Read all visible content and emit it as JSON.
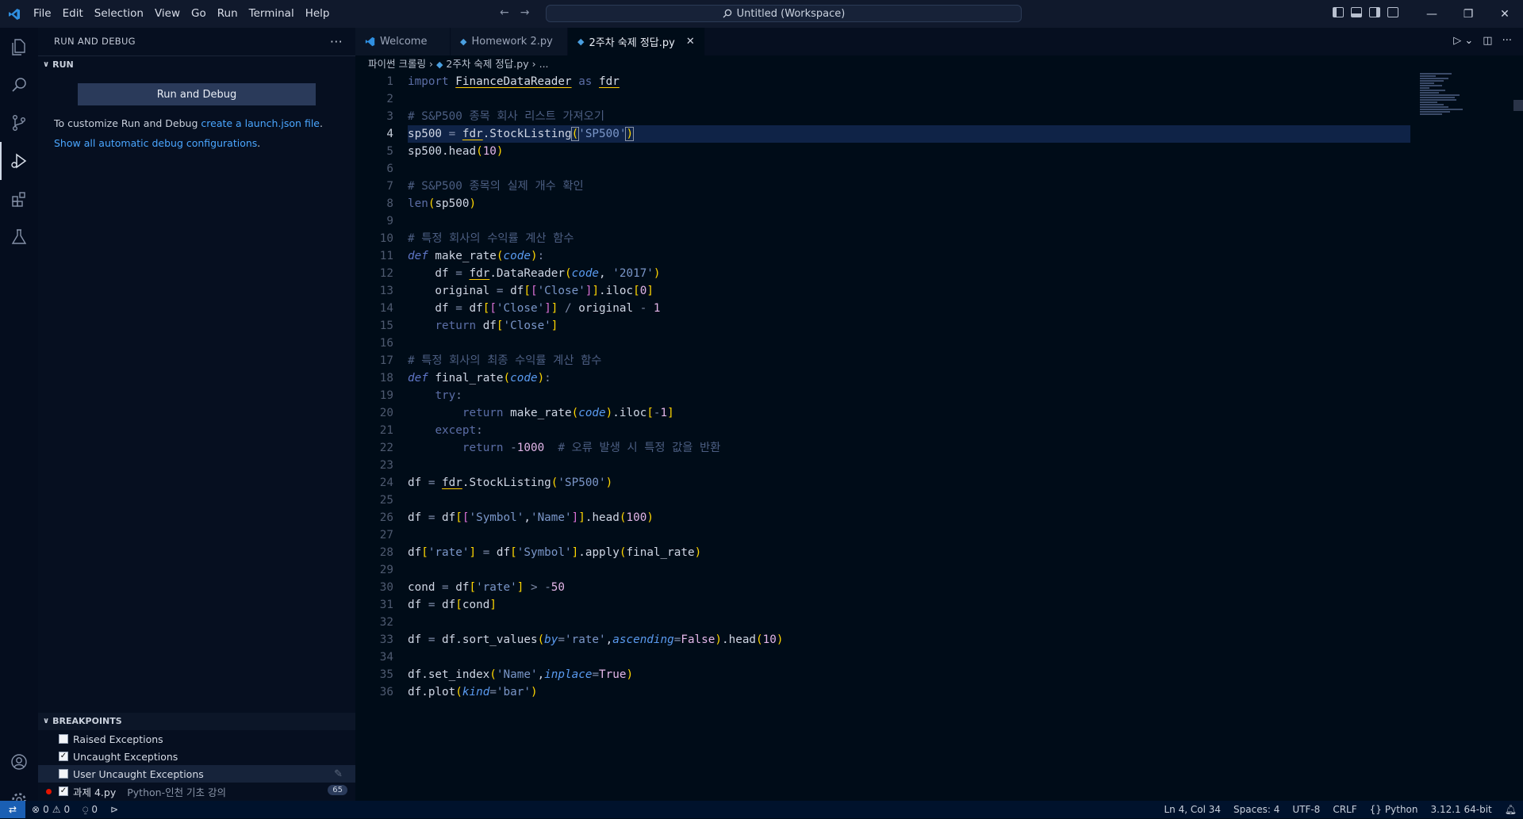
{
  "menu": [
    "File",
    "Edit",
    "Selection",
    "View",
    "Go",
    "Run",
    "Terminal",
    "Help"
  ],
  "command_center": "Untitled (Workspace)",
  "sidebar": {
    "title": "RUN AND DEBUG",
    "run_section": "RUN",
    "run_button": "Run and Debug",
    "customize_prefix": "To customize Run and Debug",
    "customize_link": "create a launch.json file",
    "customize_suffix": ".",
    "show_all_link": "Show all automatic debug configurations",
    "show_all_suffix": ".",
    "breakpoints_title": "BREAKPOINTS",
    "breakpoints": [
      {
        "label": "Raised Exceptions",
        "checked": false
      },
      {
        "label": "Uncaught Exceptions",
        "checked": true
      },
      {
        "label": "User Uncaught Exceptions",
        "checked": false
      },
      {
        "label": "과제 4.py",
        "sub": "Python-인천 기초 강의",
        "checked": true,
        "count": "65"
      }
    ]
  },
  "tabs": [
    {
      "label": "Welcome",
      "active": false
    },
    {
      "label": "Homework 2.py",
      "active": false
    },
    {
      "label": "2주차 숙제 정답.py",
      "active": true
    }
  ],
  "breadcrumb": {
    "folder": "파이썬 크롤링",
    "file": "2주차 숙제 정답.py",
    "rest": "..."
  },
  "editor": {
    "current_line": 4,
    "lines": [
      "import FinanceDataReader as fdr",
      "",
      "# S&P500 종목 회사 리스트 가져오기",
      "sp500 = fdr.StockListing('SP500')",
      "sp500.head(10)",
      "",
      "# S&P500 종목의 실제 개수 확인",
      "len(sp500)",
      "",
      "# 특정 회사의 수익률 계산 함수",
      "def make_rate(code):",
      "    df = fdr.DataReader(code, '2017')",
      "    original = df[['Close']].iloc[0]",
      "    df = df[['Close']] / original - 1",
      "    return df['Close']",
      "",
      "# 특정 회사의 최종 수익률 계산 함수",
      "def final_rate(code):",
      "    try:",
      "        return make_rate(code).iloc[-1]",
      "    except:",
      "        return -1000  # 오류 발생 시 특정 값을 반환",
      "",
      "df = fdr.StockListing('SP500')",
      "",
      "df = df[['Symbol','Name']].head(100)",
      "",
      "df['rate'] = df['Symbol'].apply(final_rate)",
      "",
      "cond = df['rate'] > -50",
      "df = df[cond]",
      "",
      "df = df.sort_values(by='rate',ascending=False).head(10)",
      "",
      "df.set_index('Name',inplace=True)",
      "df.plot(kind='bar')"
    ]
  },
  "status": {
    "errors": "0",
    "warnings": "0",
    "ports": "0",
    "position": "Ln 4, Col 34",
    "spaces": "Spaces: 4",
    "encoding": "UTF-8",
    "eol": "CRLF",
    "language": "Python",
    "interpreter": "3.12.1 64-bit"
  }
}
